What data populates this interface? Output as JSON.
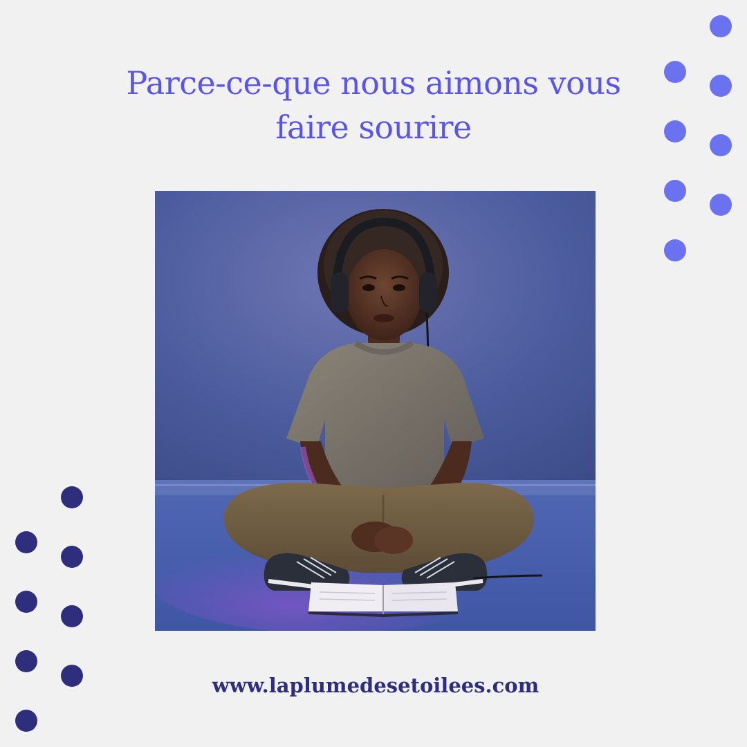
{
  "headline": {
    "line1": "Parce-ce-que nous aimons vous",
    "line2": "faire sourire"
  },
  "website": "www.laplumedesetoilees.com",
  "colors": {
    "background": "#f1f1f1",
    "headline": "#5b55e6",
    "dot_light": "#6b72f0",
    "dot_dark": "#2f2e7d",
    "website": "#2f2e7d"
  },
  "photo": {
    "subject": "illustration-girl-with-headphones-reading-book"
  }
}
